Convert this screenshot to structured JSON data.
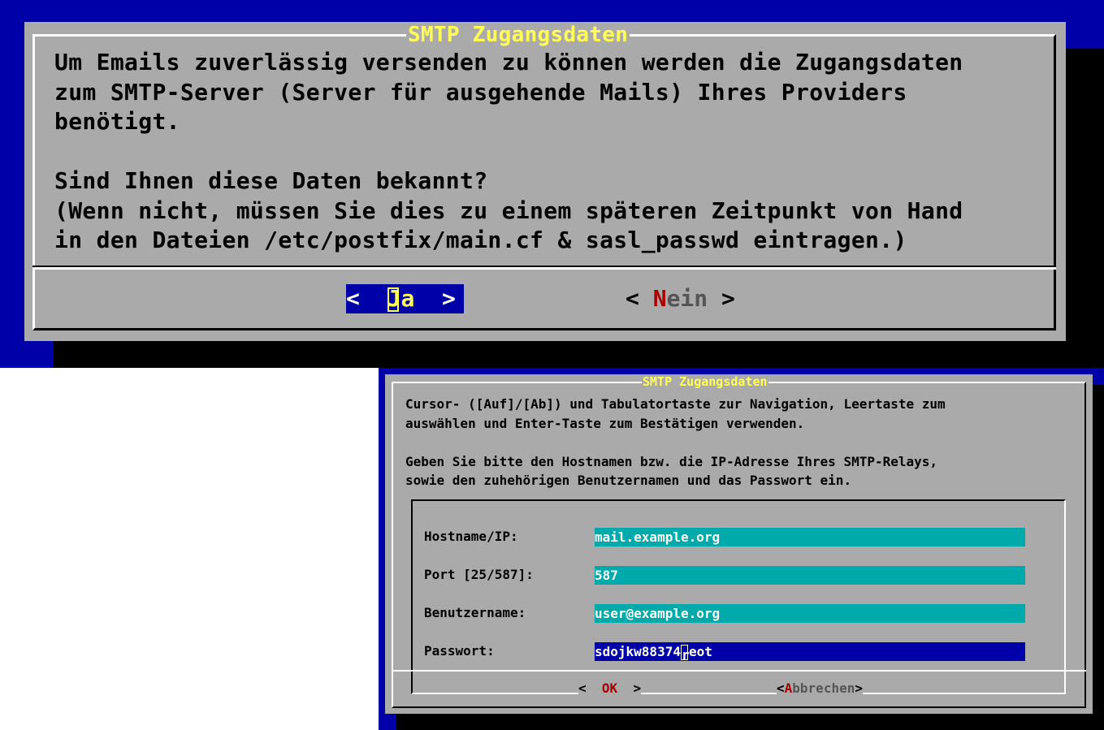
{
  "dialog1": {
    "title": "SMTP Zugangsdaten",
    "body": "Um Emails zuverlässig versenden zu können werden die Zugangsdaten\nzum SMTP-Server (Server für ausgehende Mails) Ihres Providers\nbenötigt.\n\nSind Ihnen diese Daten bekannt?\n(Wenn nicht, müssen Sie dies zu einem späteren Zeitpunkt von Hand\nin den Dateien /etc/postfix/main.cf & sasl_passwd eintragen.)",
    "yes_button": {
      "open": "<  ",
      "hotkey": "J",
      "rest": "a",
      "close": "  >"
    },
    "no_button": {
      "open": "< ",
      "hotkey": "N",
      "rest": "ein",
      "close": " >"
    }
  },
  "dialog2": {
    "title": "SMTP Zugangsdaten",
    "body": "Cursor- ([Auf]/[Ab]) und Tabulatortaste zur Navigation, Leertaste zum\nauswählen und Enter-Taste zum Bestätigen verwenden.\n\nGeben Sie bitte den Hostnamen bzw. die IP-Adresse Ihres SMTP-Relays,\nsowie den zuhehörigen Benutzernamen und das Passwort ein.",
    "fields": [
      {
        "label": "Hostname/IP:",
        "value": "mail.example.org"
      },
      {
        "label": "Port [25/587]:",
        "value": "587"
      },
      {
        "label": "Benutzername:",
        "value": "user@example.org"
      },
      {
        "label": "Passwort:",
        "value_before": "sdojkw88374",
        "value_cursor": "r",
        "value_after": "eot"
      }
    ],
    "ok_button": {
      "open": "<  ",
      "hotkey": "OK",
      "close": "  >"
    },
    "cancel_button": {
      "open": "<",
      "hotkey": "A",
      "rest": "bbrechen",
      "close": ">"
    }
  },
  "colors": {
    "background": "#0000a8",
    "dialog": "#aaaaaa",
    "title": "#ffff55",
    "hotkey": "#a80000",
    "field": "#00aaaa",
    "active_field": "#0000a8"
  }
}
